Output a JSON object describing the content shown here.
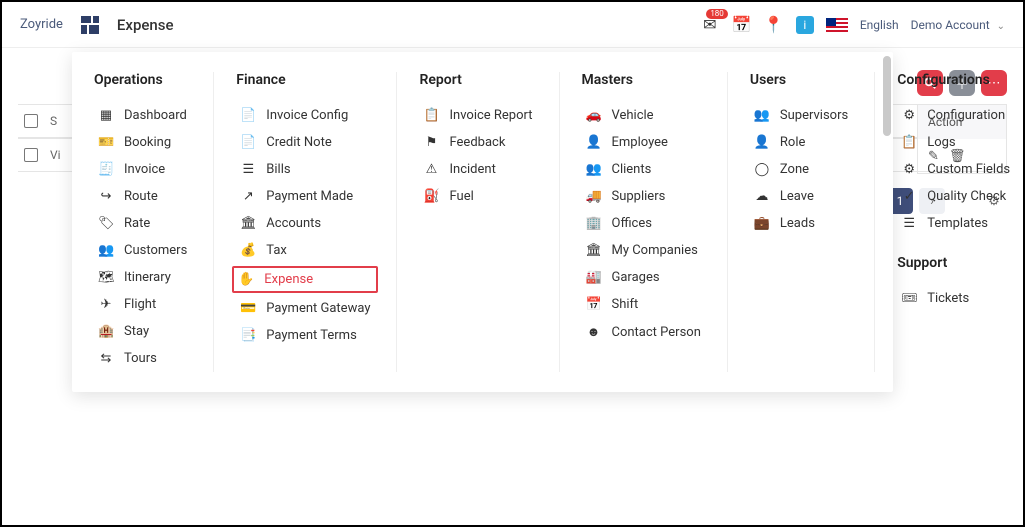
{
  "header": {
    "brand": "Zoyride",
    "page_title": "Expense",
    "inbox_badge": "180",
    "language": "English",
    "account": "Demo Account"
  },
  "toolbar": {
    "search": "search",
    "add": "add",
    "more": "more"
  },
  "grid": {
    "row1_label": "S",
    "row2_label": "Vi",
    "action_header": "Action",
    "page_number": "1"
  },
  "menu": {
    "operations": {
      "title": "Operations",
      "items": [
        {
          "icon": "dashboard",
          "label": "Dashboard"
        },
        {
          "icon": "booking",
          "label": "Booking"
        },
        {
          "icon": "invoice",
          "label": "Invoice"
        },
        {
          "icon": "route",
          "label": "Route"
        },
        {
          "icon": "rate",
          "label": "Rate"
        },
        {
          "icon": "customers",
          "label": "Customers"
        },
        {
          "icon": "itinerary",
          "label": "Itinerary"
        },
        {
          "icon": "flight",
          "label": "Flight"
        },
        {
          "icon": "stay",
          "label": "Stay"
        },
        {
          "icon": "tours",
          "label": "Tours"
        }
      ]
    },
    "finance": {
      "title": "Finance",
      "items": [
        {
          "icon": "invoice-config",
          "label": "Invoice Config"
        },
        {
          "icon": "credit-note",
          "label": "Credit Note"
        },
        {
          "icon": "bills",
          "label": "Bills"
        },
        {
          "icon": "payment-made",
          "label": "Payment Made"
        },
        {
          "icon": "accounts",
          "label": "Accounts"
        },
        {
          "icon": "tax",
          "label": "Tax"
        },
        {
          "icon": "expense",
          "label": "Expense",
          "active": true
        },
        {
          "icon": "payment-gateway",
          "label": "Payment Gateway"
        },
        {
          "icon": "payment-terms",
          "label": "Payment Terms"
        }
      ]
    },
    "report": {
      "title": "Report",
      "items": [
        {
          "icon": "invoice-report",
          "label": "Invoice Report"
        },
        {
          "icon": "feedback",
          "label": "Feedback"
        },
        {
          "icon": "incident",
          "label": "Incident"
        },
        {
          "icon": "fuel",
          "label": "Fuel"
        }
      ]
    },
    "masters": {
      "title": "Masters",
      "items": [
        {
          "icon": "vehicle",
          "label": "Vehicle"
        },
        {
          "icon": "employee",
          "label": "Employee"
        },
        {
          "icon": "clients",
          "label": "Clients"
        },
        {
          "icon": "suppliers",
          "label": "Suppliers"
        },
        {
          "icon": "offices",
          "label": "Offices"
        },
        {
          "icon": "my-companies",
          "label": "My Companies"
        },
        {
          "icon": "garages",
          "label": "Garages"
        },
        {
          "icon": "shift",
          "label": "Shift"
        },
        {
          "icon": "contact-person",
          "label": "Contact Person"
        }
      ]
    },
    "users": {
      "title": "Users",
      "items": [
        {
          "icon": "supervisors",
          "label": "Supervisors"
        },
        {
          "icon": "role",
          "label": "Role"
        },
        {
          "icon": "zone",
          "label": "Zone"
        },
        {
          "icon": "leave",
          "label": "Leave"
        },
        {
          "icon": "leads",
          "label": "Leads"
        }
      ]
    },
    "configurations": {
      "title": "Configurations",
      "items": [
        {
          "icon": "configuration",
          "label": "Configuration"
        },
        {
          "icon": "logs",
          "label": "Logs"
        },
        {
          "icon": "custom-fields",
          "label": "Custom Fields"
        },
        {
          "icon": "quality-check",
          "label": "Quality Check"
        },
        {
          "icon": "templates",
          "label": "Templates"
        }
      ]
    },
    "support": {
      "title": "Support",
      "items": [
        {
          "icon": "tickets",
          "label": "Tickets"
        }
      ]
    }
  },
  "icons": {
    "dashboard": "▦",
    "booking": "🎫",
    "invoice": "🧾",
    "route": "↪",
    "rate": "🏷",
    "customers": "👥",
    "itinerary": "🗺",
    "flight": "✈",
    "stay": "🏨",
    "tours": "⇆",
    "invoice-config": "📄",
    "credit-note": "📄",
    "bills": "☰",
    "payment-made": "↗",
    "accounts": "🏛",
    "tax": "💰",
    "expense": "✋",
    "payment-gateway": "💳",
    "payment-terms": "📑",
    "invoice-report": "📋",
    "feedback": "⚑",
    "incident": "⚠",
    "fuel": "⛽",
    "vehicle": "🚗",
    "employee": "👤",
    "clients": "👥",
    "suppliers": "🚚",
    "offices": "🏢",
    "my-companies": "🏛",
    "garages": "🏭",
    "shift": "📅",
    "contact-person": "☻",
    "supervisors": "👥",
    "role": "👤",
    "zone": "◯",
    "leave": "☁",
    "leads": "💼",
    "configuration": "⚙",
    "logs": "📋",
    "custom-fields": "⚙",
    "quality-check": "✓",
    "templates": "☰",
    "tickets": "🎟"
  }
}
